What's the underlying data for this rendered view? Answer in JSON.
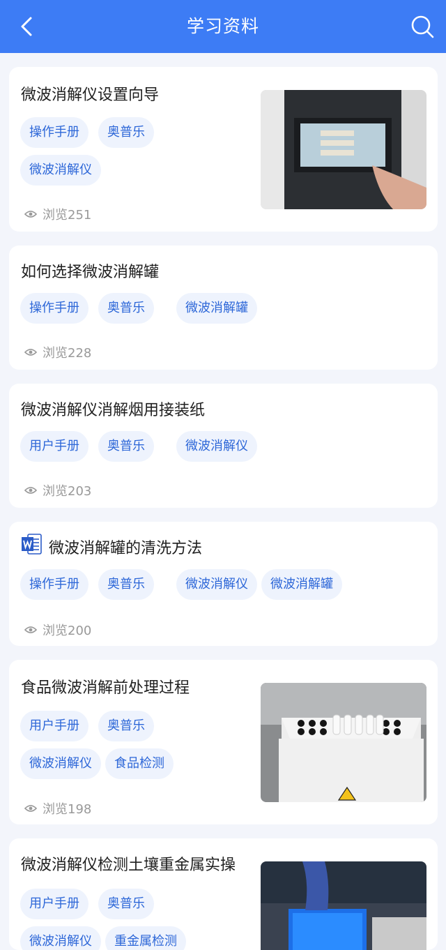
{
  "header": {
    "title": "学习资料",
    "back_icon": "back-arrow-icon",
    "search_icon": "search-icon",
    "background": "#3d7cf5"
  },
  "articles": [
    {
      "title": "微波消解仪设置向导",
      "tags": [
        "操作手册",
        "奥普乐",
        "微波消解仪"
      ],
      "views": "浏览251",
      "has_thumbnail": true
    },
    {
      "title": "如何选择微波消解罐",
      "tags": [
        "操作手册",
        "奥普乐",
        "微波消解罐"
      ],
      "views": "浏览228",
      "has_thumbnail": false
    },
    {
      "title": "微波消解仪消解烟用接装纸",
      "tags": [
        "用户手册",
        "奥普乐",
        "微波消解仪"
      ],
      "views": "浏览203",
      "has_thumbnail": false
    },
    {
      "title": "微波消解罐的清洗方法",
      "tags": [
        "操作手册",
        "奥普乐",
        "微波消解仪",
        "微波消解罐"
      ],
      "views": "浏览200",
      "has_thumbnail": false,
      "doc_icon": "word-doc-icon"
    },
    {
      "title": "食品微波消解前处理过程",
      "tags": [
        "用户手册",
        "奥普乐",
        "微波消解仪",
        "食品检测"
      ],
      "views": "浏览198",
      "has_thumbnail": true
    },
    {
      "title": "微波消解仪检测土壤重金属实操",
      "tags": [
        "用户手册",
        "奥普乐",
        "微波消解仪",
        "重金属检测"
      ],
      "views": "",
      "has_thumbnail": true
    }
  ],
  "colors": {
    "tag_bg": "#eef3fd",
    "tag_text": "#2d67d8",
    "page_bg": "#f3f5fb"
  }
}
